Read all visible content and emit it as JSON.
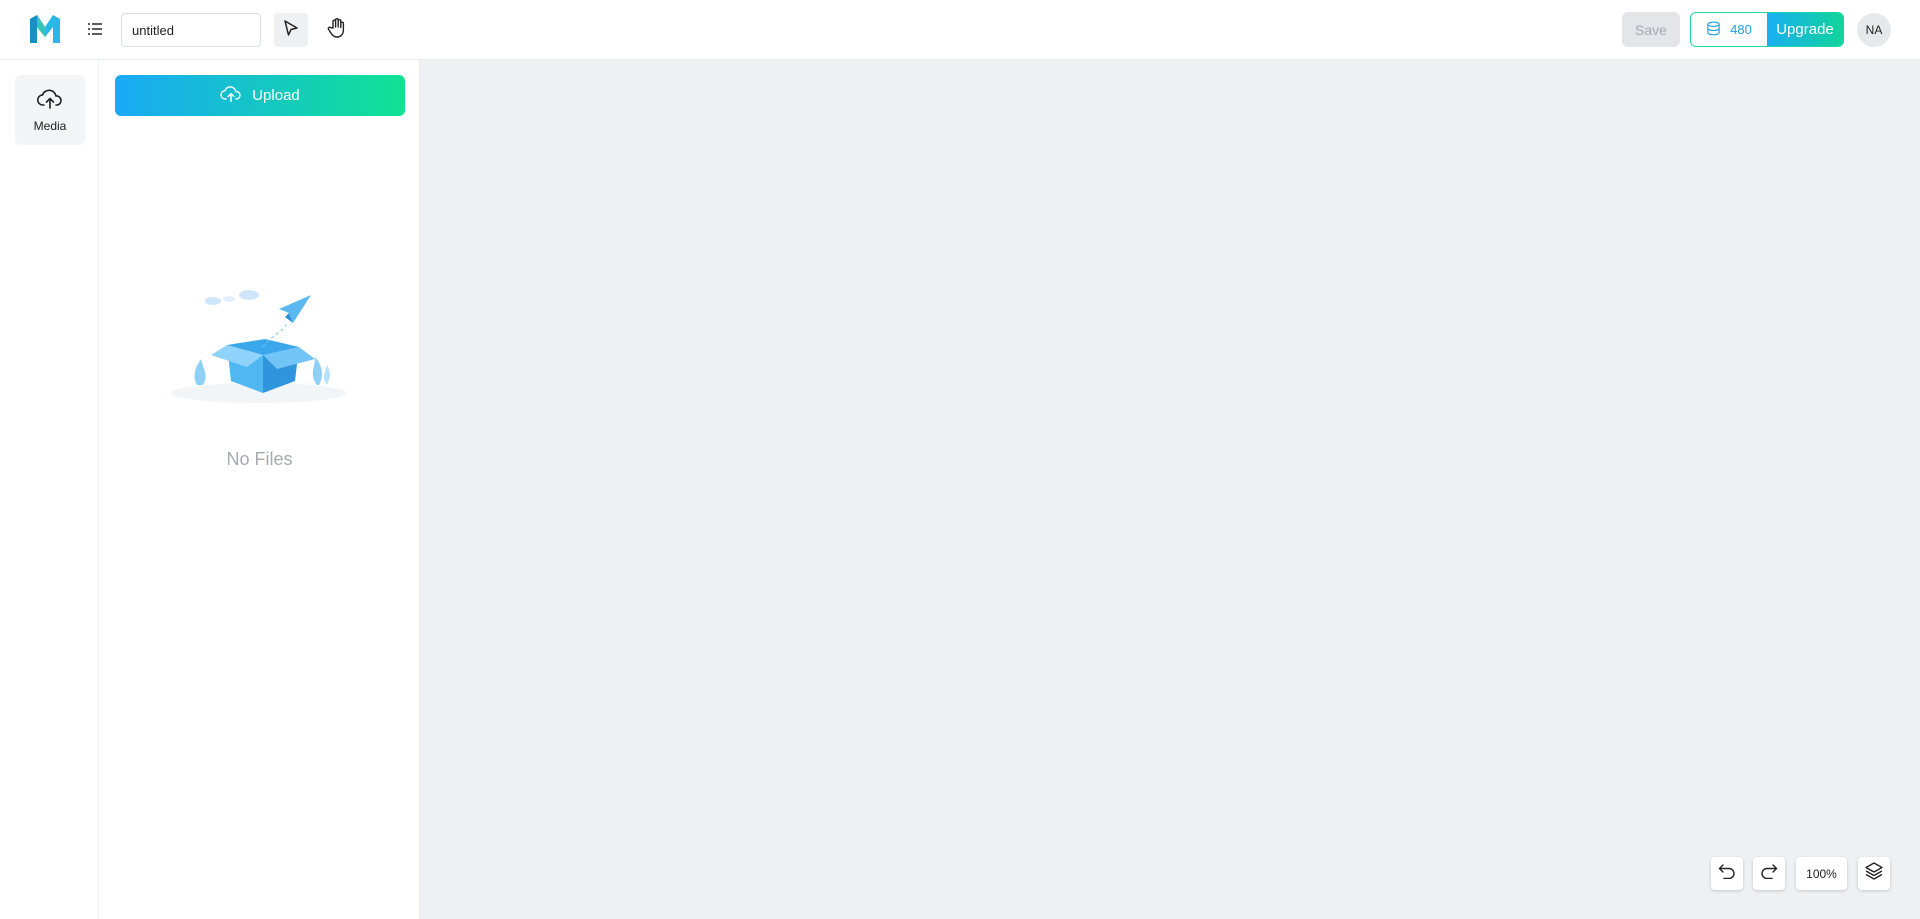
{
  "header": {
    "logo_icon": "logo-icon",
    "menu_icon": "menu-icon",
    "title_value": "untitled",
    "tools": {
      "select_icon": "pointer-icon",
      "hand_icon": "hand-icon"
    },
    "save_label": "Save",
    "credits": "480",
    "credits_icon": "database-icon",
    "upgrade_label": "Upgrade",
    "avatar_initials": "NA"
  },
  "sidebar": {
    "items": [
      {
        "label": "Media",
        "icon": "cloud-upload-icon",
        "active": true
      }
    ]
  },
  "panel": {
    "upload_label": "Upload",
    "empty_text": "No Files"
  },
  "canvas": {
    "controls": {
      "undo_icon": "undo-icon",
      "redo_icon": "redo-icon",
      "zoom_label": "100%",
      "layers_icon": "layers-icon"
    }
  },
  "colors": {
    "accent_blue": "#19aef2",
    "accent_green": "#10d59a",
    "canvas_bg": "#eef1f4",
    "credits_text": "#1e9ee0"
  }
}
